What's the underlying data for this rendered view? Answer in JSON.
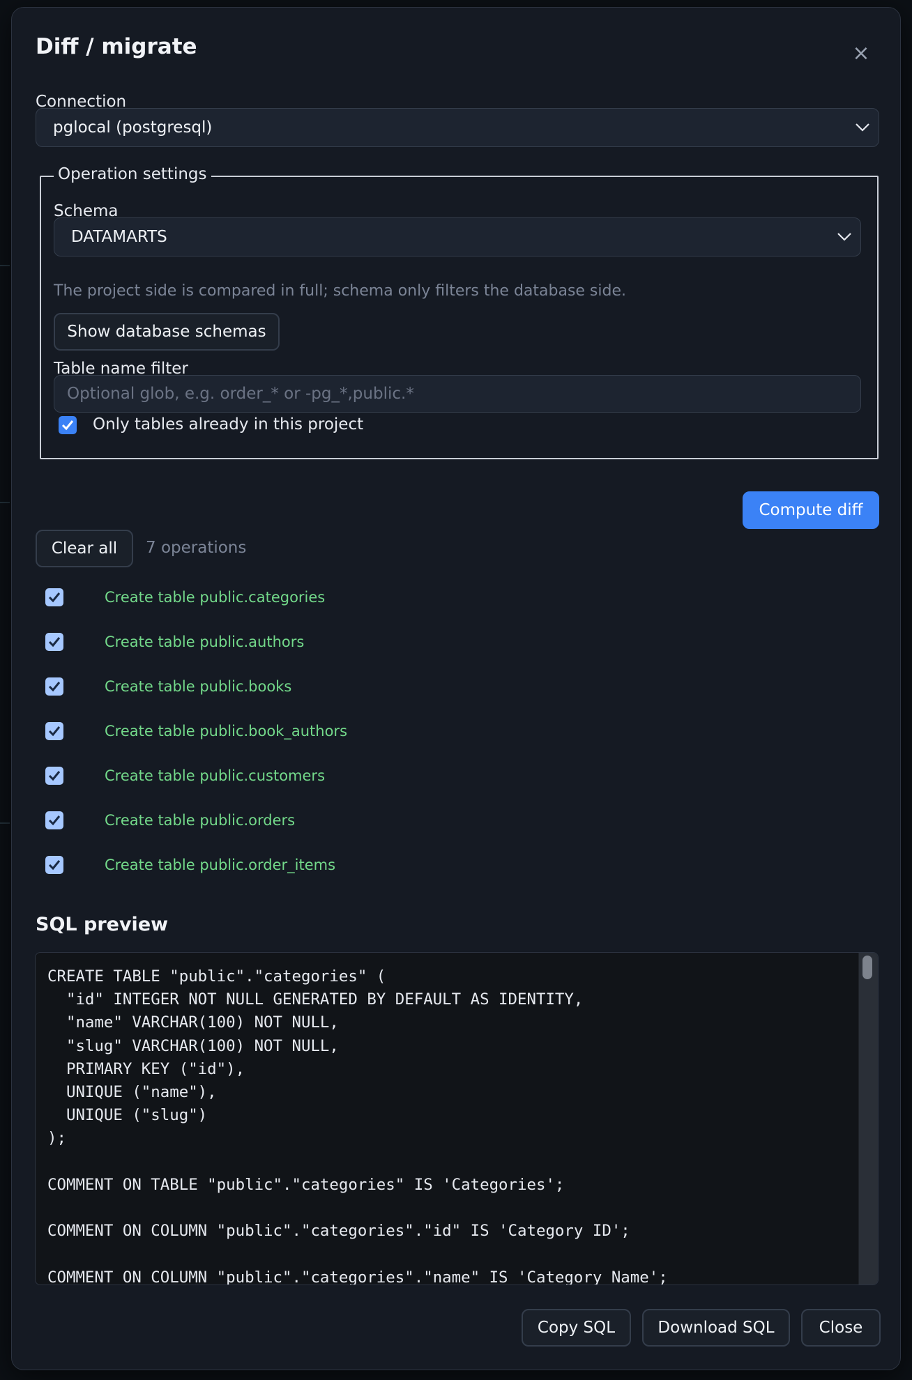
{
  "dialog": {
    "title": "Diff / migrate",
    "close_glyph": "×"
  },
  "connection": {
    "label": "Connection",
    "value": "pglocal (postgresql)"
  },
  "operation_settings": {
    "legend": "Operation settings",
    "schema_label": "Schema",
    "schema_value": "DATAMARTS",
    "schema_hint": "The project side is compared in full; schema only filters the database side.",
    "show_schemas_button": "Show database schemas",
    "filter_label": "Table name filter",
    "filter_value": "",
    "filter_placeholder": "Optional glob, e.g. order_* or -pg_*,public.*",
    "only_project_tables_label": "Only tables already in this project",
    "only_project_tables_checked": true
  },
  "actions": {
    "compute_diff": "Compute diff",
    "clear_all": "Clear all",
    "operation_count": "7 operations"
  },
  "operations": [
    {
      "label": "Create table public.categories",
      "checked": true
    },
    {
      "label": "Create table public.authors",
      "checked": true
    },
    {
      "label": "Create table public.books",
      "checked": true
    },
    {
      "label": "Create table public.book_authors",
      "checked": true
    },
    {
      "label": "Create table public.customers",
      "checked": true
    },
    {
      "label": "Create table public.orders",
      "checked": true
    },
    {
      "label": "Create table public.order_items",
      "checked": true
    }
  ],
  "sql_preview": {
    "title": "SQL preview",
    "text": "CREATE TABLE \"public\".\"categories\" (\n  \"id\" INTEGER NOT NULL GENERATED BY DEFAULT AS IDENTITY,\n  \"name\" VARCHAR(100) NOT NULL,\n  \"slug\" VARCHAR(100) NOT NULL,\n  PRIMARY KEY (\"id\"),\n  UNIQUE (\"name\"),\n  UNIQUE (\"slug\")\n);\n\nCOMMENT ON TABLE \"public\".\"categories\" IS 'Categories';\n\nCOMMENT ON COLUMN \"public\".\"categories\".\"id\" IS 'Category ID';\n\nCOMMENT ON COLUMN \"public\".\"categories\".\"name\" IS 'Category Name';"
  },
  "footer": {
    "copy_sql": "Copy SQL",
    "download_sql": "Download SQL",
    "close": "Close"
  },
  "colors": {
    "accent": "#3b82f6",
    "operation_text": "#73d98a",
    "background": "#151a23"
  }
}
